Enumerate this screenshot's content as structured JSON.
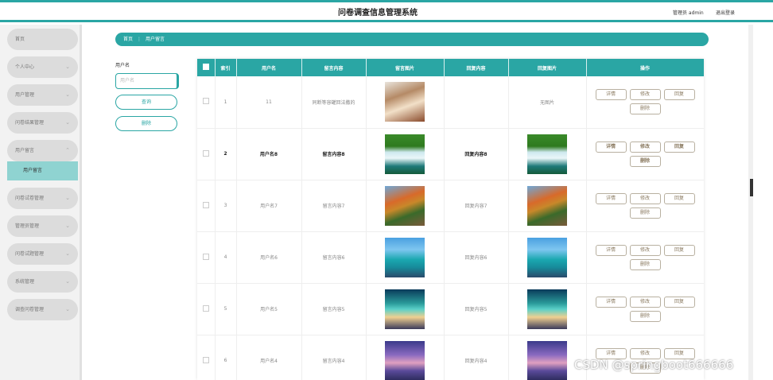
{
  "header": {
    "title": "问卷调查信息管理系统",
    "admin_label": "管理员 admin",
    "logout_label": "退出登录"
  },
  "sidebar": {
    "items": [
      {
        "label": "首页",
        "chevron": ""
      },
      {
        "label": "个人中心",
        "chevron": "⌄"
      },
      {
        "label": "用户管理",
        "chevron": "⌄"
      },
      {
        "label": "问卷结果管理",
        "chevron": "⌄"
      },
      {
        "label": "用户留言",
        "chevron": "⌃"
      },
      {
        "label": "问卷试卷管理",
        "chevron": "⌄"
      },
      {
        "label": "管理员管理",
        "chevron": "⌄"
      },
      {
        "label": "问卷试题管理",
        "chevron": "⌄"
      },
      {
        "label": "系统管理",
        "chevron": "⌄"
      },
      {
        "label": "调查问卷管理",
        "chevron": "⌄"
      }
    ],
    "active_sub": "用户留言"
  },
  "breadcrumb": {
    "home": "首页",
    "separator": "⋮",
    "current": "用户留言"
  },
  "filter": {
    "label": "用户名",
    "placeholder": "用户名",
    "search_button": "查询",
    "delete_button": "删除"
  },
  "table": {
    "headers": [
      "索引",
      "用户名",
      "留言内容",
      "留言图片",
      "回复内容",
      "回复图片",
      "操作"
    ],
    "rows": [
      {
        "index": "1",
        "username": "11",
        "content": "同断等容罐回法撒的",
        "reply": "",
        "reply_image_text": "无图片"
      },
      {
        "index": "2",
        "username": "用户名8",
        "content": "留言内容8",
        "reply": "回复内容8",
        "reply_image_text": ""
      },
      {
        "index": "3",
        "username": "用户名7",
        "content": "留言内容7",
        "reply": "回复内容7",
        "reply_image_text": ""
      },
      {
        "index": "4",
        "username": "用户名6",
        "content": "留言内容6",
        "reply": "回复内容6",
        "reply_image_text": ""
      },
      {
        "index": "5",
        "username": "用户名5",
        "content": "留言内容5",
        "reply": "回复内容5",
        "reply_image_text": ""
      },
      {
        "index": "6",
        "username": "用户名4",
        "content": "留言内容4",
        "reply": "回复内容4",
        "reply_image_text": ""
      }
    ],
    "actions": {
      "detail": "详情",
      "edit": "修改",
      "reply": "回复",
      "delete": "删除"
    }
  },
  "watermark": "CSDN @springboot666666",
  "colors": {
    "accent": "#2aa6a4",
    "submenu_active": "#8fd3d1"
  }
}
